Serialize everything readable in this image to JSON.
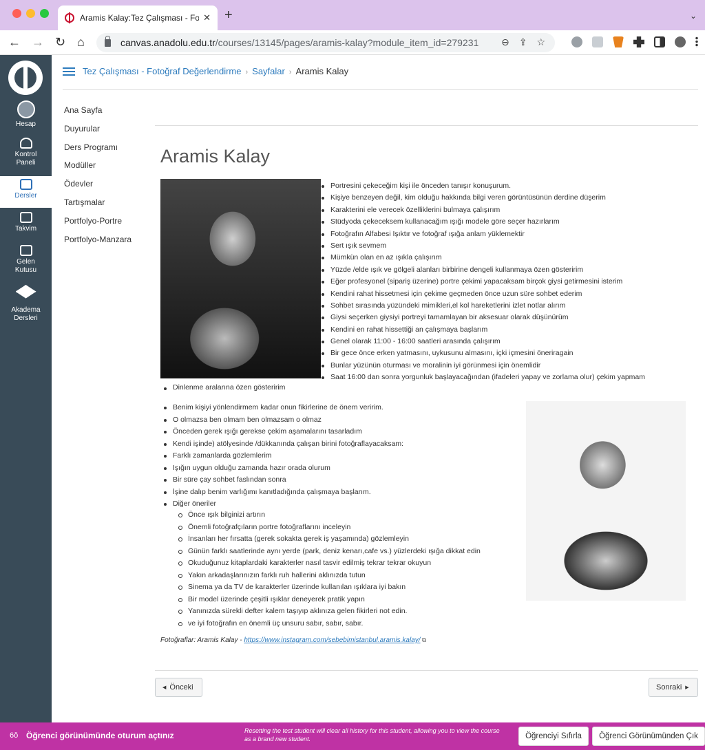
{
  "browser": {
    "tab_title": "Aramis Kalay:Tez Çalışması - Fo",
    "tab_close": "✕",
    "new_tab": "+",
    "url_host": "canvas.anadolu.edu.tr",
    "url_path": "/courses/13145/pages/aramis-kalay?module_item_id=279231",
    "icons": [
      "back-icon",
      "forward-icon",
      "reload-icon",
      "home-icon",
      "lock-icon",
      "zoom-icon",
      "share-icon",
      "star-icon"
    ]
  },
  "globalnav": {
    "items": [
      {
        "label": "Hesap",
        "icon": "avatar-icon"
      },
      {
        "label": "Kontrol\nPaneli",
        "icon": "dashboard-icon"
      },
      {
        "label": "Dersler",
        "icon": "courses-icon"
      },
      {
        "label": "Takvim",
        "icon": "calendar-icon"
      },
      {
        "label": "Gelen\nKutusu",
        "icon": "inbox-icon"
      },
      {
        "label": "Akadema\nDersleri",
        "icon": "graduation-cap-icon"
      }
    ]
  },
  "breadcrumb": {
    "course": "Tez Çalışması - Fotoğraf Değerlendirme",
    "section": "Sayfalar",
    "current": "Aramis Kalay",
    "separator": "›"
  },
  "coursenav": {
    "items": [
      "Ana Sayfa",
      "Duyurular",
      "Ders Programı",
      "Modüller",
      "Ödevler",
      "Tartışmalar",
      "Portfolyo-Portre",
      "Portfolyo-Manzara"
    ]
  },
  "page": {
    "title": "Aramis Kalay",
    "list1": [
      "Portresini çekeceğim kişi ile önceden tanışır konuşurum.",
      "Kişiye benzeyen değil, kim olduğu hakkında bilgi veren görüntüsünün derdine düşerim",
      "Karakterini ele verecek özelliklerini bulmaya çalışırım",
      "Stüdyoda çekeceksem kullanacağım ışığı modele göre seçer hazırlarım",
      "Fotoğrafın Alfabesi Işıktır ve fotoğraf ışığa anlam yüklemektir",
      "Sert ışık sevmem",
      "Mümkün olan en az ışıkla çalışırım",
      "Yüzde /elde ışık ve gölgeli alanları birbirine dengeli kullanmaya özen gösteririm",
      "Eğer profesyonel (sipariş üzerine) portre çekimi yapacaksam birçok giysi getirmesini isterim",
      "Kendini rahat hissetmesi için çekime geçmeden önce uzun süre sohbet ederim",
      "Sohbet sırasında yüzündeki mimikleri,el kol hareketlerini izlet notlar alırım",
      "Giysi seçerken giysiyi portreyi tamamlayan bir aksesuar olarak düşünürüm",
      "Kendini en rahat hissettiği an çalışmaya başlarım",
      "Genel olarak 11:00 - 16:00 saatleri arasında çalışırım",
      "Bir gece önce erken yatmasını, uykusunu almasını, içki içmesini öneriragain",
      "Bunlar yüzünün oturması ve moralinin iyi görünmesi için önemlidir",
      "Saat 16:00 dan sonra yorgunluk başlayacağından (ifadeleri yapay ve zorlama olur) çekim yapmam"
    ],
    "rest_item": "Dinlenme aralarına özen gösteririm",
    "list2": [
      "Benim kişiyi yönlendirmem kadar onun fikirlerine de önem veririm.",
      "O olmazsa ben olmam ben olmazsam o olmaz",
      "Önceden gerek ışığı gerekse çekim aşamalarını tasarladım",
      "Kendi işinde) atölyesinde /dükkanında çalışan birini fotoğraflayacaksam:",
      "Farklı zamanlarda gözlemlerim",
      "Işığın uygun olduğu zamanda hazır orada olurum",
      "Bir süre çay sohbet faslından sonra",
      "İşine dalıp benim varlığımı kanıtladığında çalışmaya başlarım.",
      "Diğer öneriler"
    ],
    "list3": [
      "Önce ışık bilginizi artırın",
      "Önemli fotoğrafçıların portre fotoğraflarını inceleyin",
      "İnsanları her fırsatta (gerek sokakta gerek iş yaşamında) gözlemleyin",
      "Günün farklı saatlerinde aynı yerde (park, deniz kenarı,cafe vs.) yüzlerdeki ışığa dikkat edin",
      "Okuduğunuz kitaplardaki karakterler nasıl tasvir edilmiş tekrar tekrar okuyun",
      "Yakın arkadaşlarınızın farklı ruh hallerini aklınızda tutun",
      "Sinema ya da TV de karakterler üzerinde kullanılan ışıklara iyi bakın",
      "Bir model üzerinde çeşitli ışıklar deneyerek pratik yapın",
      "Yanınızda sürekli defter kalem taşıyıp aklınıza gelen fikirleri not edin.",
      "ve iyi fotoğrafın en önemli üç unsuru sabır, sabır, sabır."
    ],
    "credit_prefix": "Fotoğraflar: Aramis Kalay - ",
    "credit_link": "https://www.instagram.com/sebebimistanbul.aramis.kalay/",
    "prev_label": "Önceki",
    "next_label": "Sonraki"
  },
  "studentbar": {
    "label": "Öğrenci görünümünde oturum açtınız",
    "note": "Resetting the test student will clear all history for this student, allowing you to view the course as a brand new student.",
    "reset_label": "Öğrenciyi Sıfırla",
    "leave_label": "Öğrenci Görünümünden Çık",
    "color": "#bf32a4"
  }
}
